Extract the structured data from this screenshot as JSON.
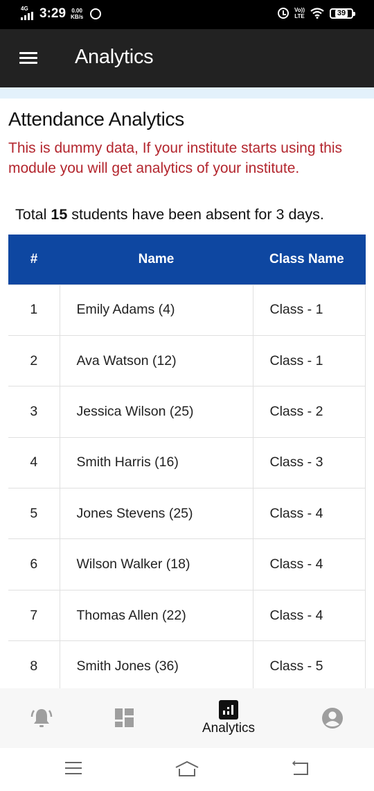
{
  "status_bar": {
    "network": "4G",
    "time": "3:29",
    "data_speed_value": "0.00",
    "data_speed_unit": "KB/s",
    "volte_top": "Vo))",
    "volte_bottom": "LTE",
    "battery": "39"
  },
  "app_bar": {
    "title": "Analytics",
    "menu_icon": "hamburger-menu-icon"
  },
  "page": {
    "heading": "Attendance Analytics",
    "notice": "This is dummy data, If your institute starts using this module you will get analytics of your institute.",
    "summary_prefix": "Total ",
    "summary_count": "15",
    "summary_suffix": " students have been absent for 3 days.",
    "colors": {
      "notice": "#b3262e",
      "table_header": "#0e47a1",
      "app_bar": "#222222"
    }
  },
  "table": {
    "columns": [
      "#",
      "Name",
      "Class Name"
    ],
    "rows": [
      {
        "num": "1",
        "name": "Emily Adams (4)",
        "class": "Class - 1"
      },
      {
        "num": "2",
        "name": "Ava Watson (12)",
        "class": "Class - 1"
      },
      {
        "num": "3",
        "name": "Jessica Wilson (25)",
        "class": "Class - 2"
      },
      {
        "num": "4",
        "name": "Smith Harris (16)",
        "class": "Class - 3"
      },
      {
        "num": "5",
        "name": "Jones Stevens (25)",
        "class": "Class - 4"
      },
      {
        "num": "6",
        "name": "Wilson Walker (18)",
        "class": "Class - 4"
      },
      {
        "num": "7",
        "name": "Thomas Allen (22)",
        "class": "Class - 4"
      },
      {
        "num": "8",
        "name": "Smith Jones (36)",
        "class": "Class - 5"
      }
    ]
  },
  "bottom_nav": {
    "items": [
      {
        "icon": "notification-bell-icon",
        "label": ""
      },
      {
        "icon": "dashboard-icon",
        "label": ""
      },
      {
        "icon": "analytics-chart-icon",
        "label": "Analytics",
        "active": true
      },
      {
        "icon": "profile-icon",
        "label": ""
      }
    ]
  },
  "system_nav": {
    "items": [
      "recent-apps",
      "home",
      "back"
    ]
  }
}
